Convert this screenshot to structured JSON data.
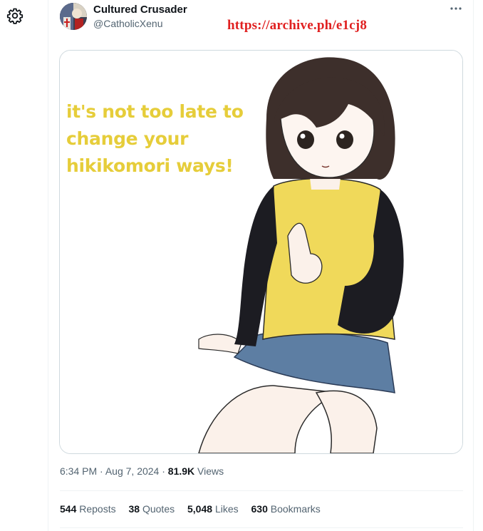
{
  "user": {
    "display_name": "Cultured Crusader",
    "handle": "@CatholicXenu"
  },
  "overlay": {
    "archive_link": "https://archive.ph/e1cj8"
  },
  "icons": {
    "settings": "gear-icon",
    "more": "more-horizontal-icon"
  },
  "media": {
    "text_lines": [
      "it's not too late to",
      "change your",
      "hikikomori ways!"
    ]
  },
  "meta": {
    "time": "6:34 PM",
    "separator": "·",
    "date": "Aug 7, 2024",
    "views_count": "81.9K",
    "views_label": "Views"
  },
  "stats": [
    {
      "count": "544",
      "label": "Reposts"
    },
    {
      "count": "38",
      "label": "Quotes"
    },
    {
      "count": "5,048",
      "label": "Likes"
    },
    {
      "count": "630",
      "label": "Bookmarks"
    }
  ],
  "colors": {
    "archive_red": "#e02020",
    "caption_yellow": "#e6cd3a",
    "secondary_text": "#536471"
  }
}
